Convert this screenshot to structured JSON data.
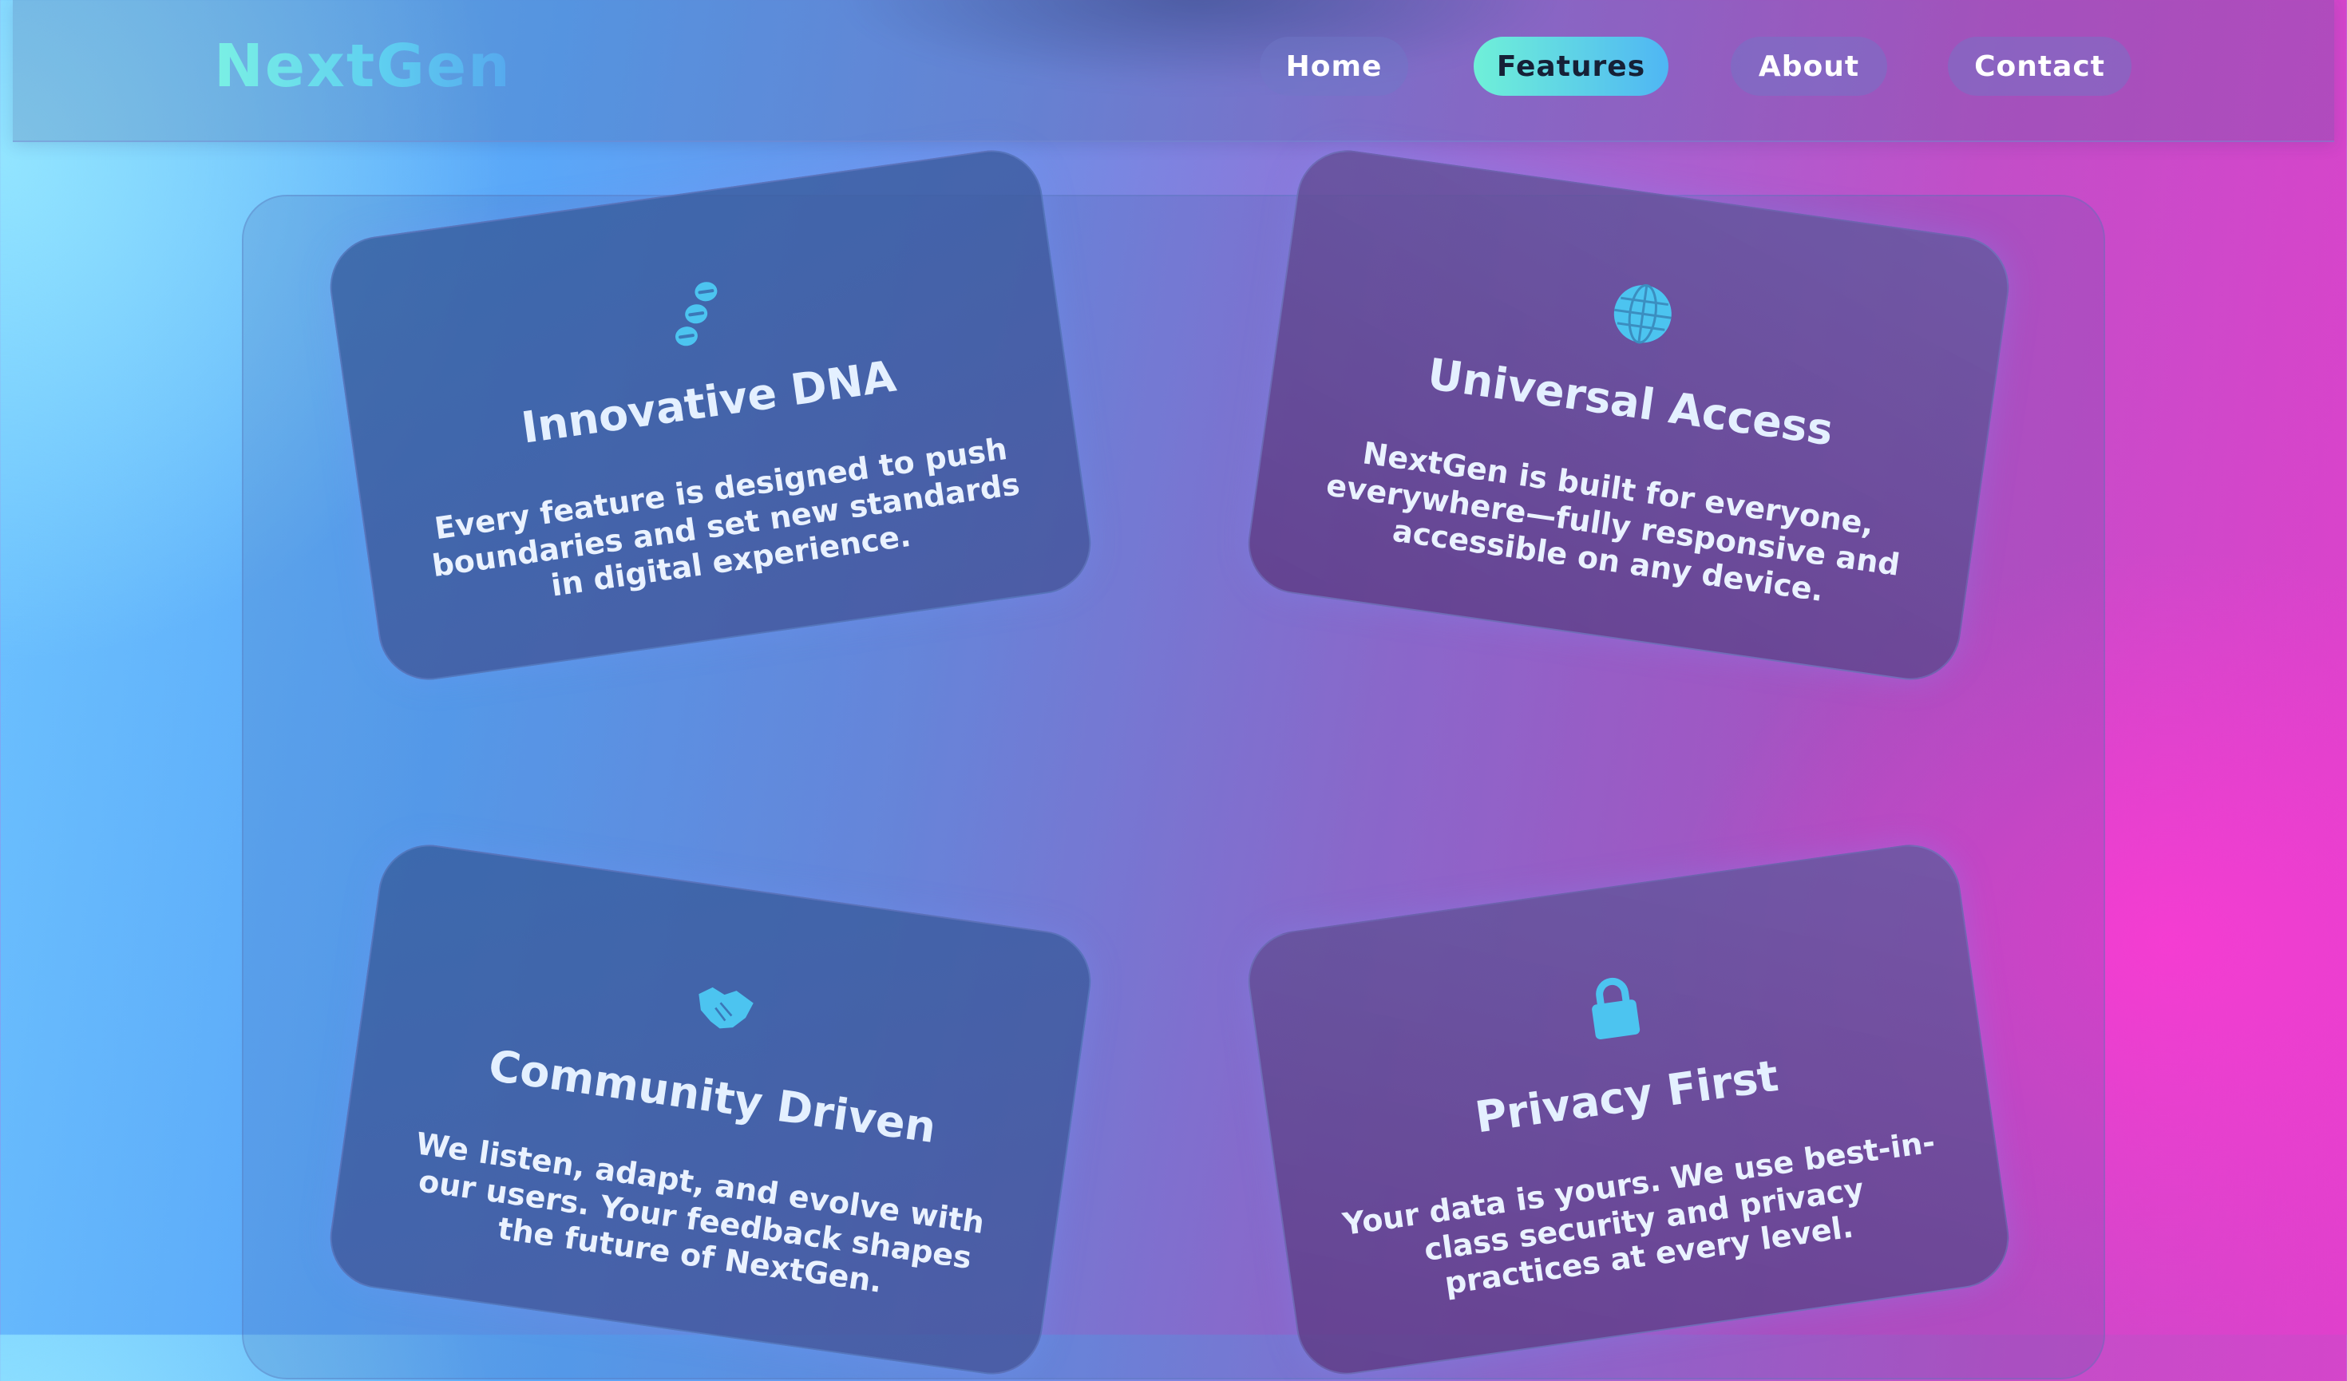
{
  "brand": {
    "name": "NextGen"
  },
  "nav": {
    "items": [
      {
        "label": "Home",
        "active": false
      },
      {
        "label": "Features",
        "active": true
      },
      {
        "label": "About",
        "active": false
      },
      {
        "label": "Contact",
        "active": false
      }
    ]
  },
  "features": [
    {
      "icon": "dna-icon",
      "title": "Innovative DNA",
      "text": "Every feature is designed to push boundaries and set new standards in digital experience."
    },
    {
      "icon": "globe-icon",
      "title": "Universal Access",
      "text": "NextGen is built for everyone, everywhere—fully responsive and accessible on any device."
    },
    {
      "icon": "handshake-icon",
      "title": "Community Driven",
      "text": "We listen, adapt, and evolve with our users. Your feedback shapes the future of NextGen."
    },
    {
      "icon": "lock-icon",
      "title": "Privacy First",
      "text": "Your data is yours. We use best-in-class security and privacy practices at every level."
    }
  ],
  "colors": {
    "accent_start": "#6ff0d8",
    "accent_end": "#4fb6f4",
    "icon": "#4cc4f0",
    "bg_left": "#6ec4ff",
    "bg_right": "#e040cc"
  }
}
